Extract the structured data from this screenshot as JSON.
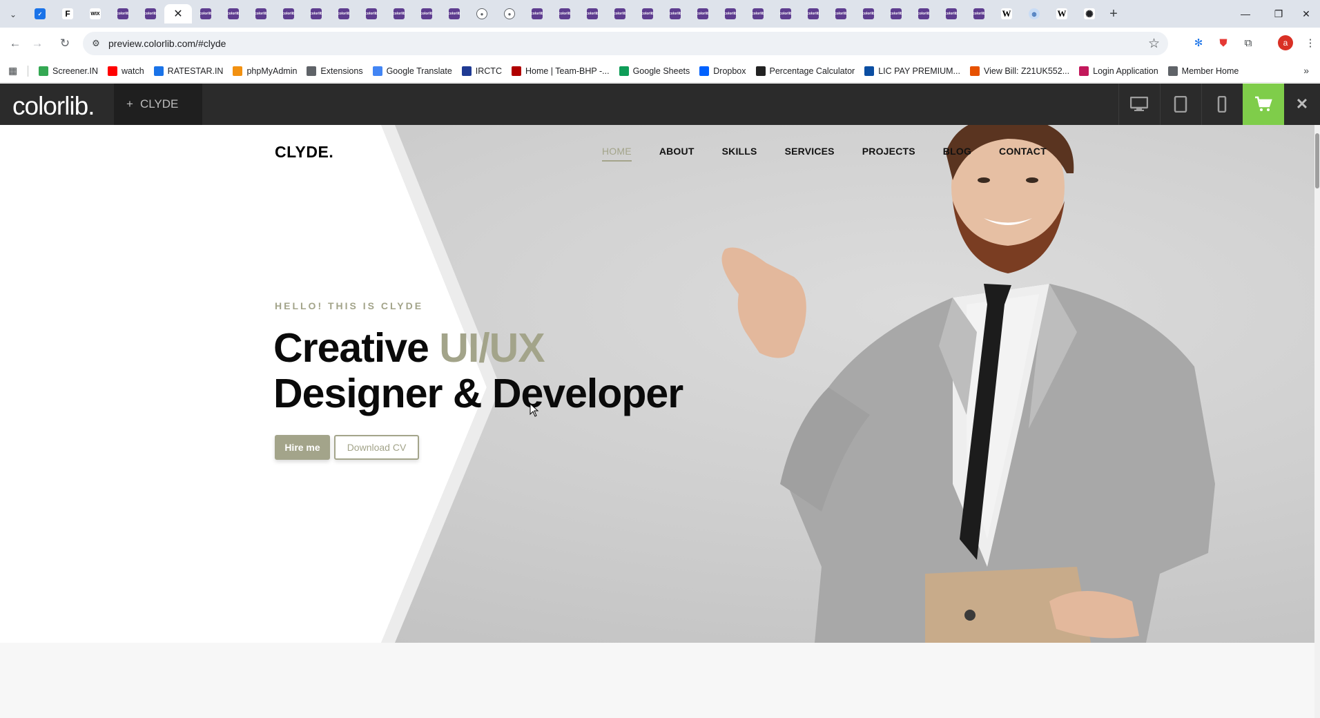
{
  "browser": {
    "active_tab_close": "✕",
    "new_tab": "+",
    "url": "preview.colorlib.com/#clyde",
    "profile_initial": "a",
    "window": {
      "minimize": "—",
      "restore": "❐",
      "close": "✕"
    }
  },
  "bookmarks": [
    {
      "label": "Screener.IN",
      "icon": "bar-chart-icon",
      "color": "#34a853"
    },
    {
      "label": "watch",
      "icon": "youtube-icon",
      "color": "#ff0000"
    },
    {
      "label": "RATESTAR.IN",
      "icon": "star-icon",
      "color": "#1a73e8"
    },
    {
      "label": "phpMyAdmin",
      "icon": "phpmyadmin-icon",
      "color": "#f29111"
    },
    {
      "label": "Extensions",
      "icon": "puzzle-icon",
      "color": "#5f6368"
    },
    {
      "label": "Google Translate",
      "icon": "translate-icon",
      "color": "#4285f4"
    },
    {
      "label": "IRCTC",
      "icon": "irctc-icon",
      "color": "#1f3a93"
    },
    {
      "label": "Home | Team-BHP -...",
      "icon": "teambhp-icon",
      "color": "#b00000"
    },
    {
      "label": "Google Sheets",
      "icon": "sheets-icon",
      "color": "#0f9d58"
    },
    {
      "label": "Dropbox",
      "icon": "dropbox-icon",
      "color": "#0061fe"
    },
    {
      "label": "Percentage Calculator",
      "icon": "percent-icon",
      "color": "#222222"
    },
    {
      "label": "LIC PAY PREMIUM...",
      "icon": "lic-icon",
      "color": "#0b4ea2"
    },
    {
      "label": "View Bill: Z21UK552...",
      "icon": "bill-icon",
      "color": "#e65100"
    },
    {
      "label": "Login Application",
      "icon": "login-icon",
      "color": "#c2185b"
    },
    {
      "label": "Member Home",
      "icon": "globe-icon",
      "color": "#5f6368"
    }
  ],
  "colorlib_bar": {
    "logo": "colorlib.",
    "theme_plus": "+",
    "theme_name": "CLYDE",
    "accent": "#7fcd4a"
  },
  "site": {
    "logo": "CLYDE.",
    "nav": [
      "HOME",
      "ABOUT",
      "SKILLS",
      "SERVICES",
      "PROJECTS",
      "BLOG",
      "CONTACT"
    ],
    "hello": "HELLO! THIS IS CLYDE",
    "headline_word1": "Creative",
    "headline_accent": "UI/UX",
    "headline_line2": "Designer & Developer",
    "hire_button": "Hire me",
    "cv_button": "Download CV",
    "accent_color": "#a3a48a"
  }
}
